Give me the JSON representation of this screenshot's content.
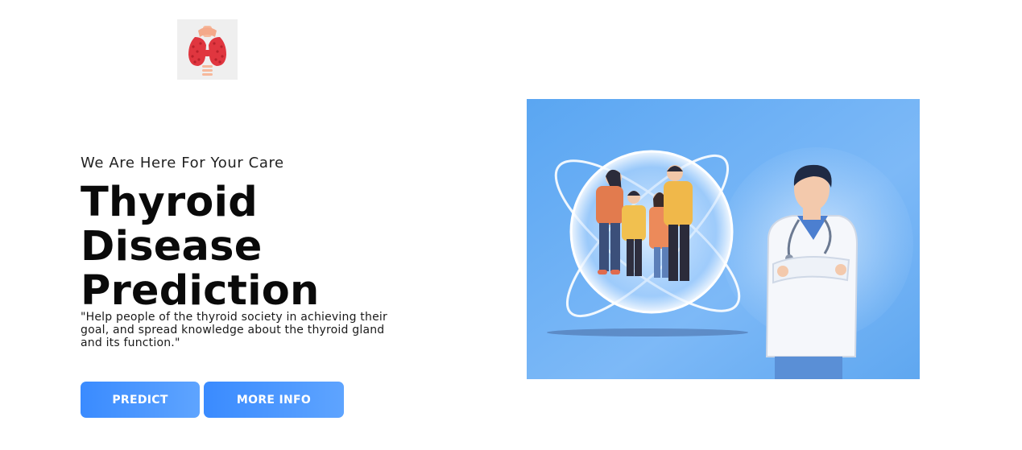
{
  "header": {
    "logo_icon": "thyroid-gland-icon"
  },
  "hero": {
    "tagline": "We Are Here For Your Care",
    "title": "Thyroid Disease Prediction",
    "quote": "\"Help people of the thyroid society in achieving their goal, and spread knowledge about the thyroid gland and its function.\"",
    "illustration": "doctor-and-family-illustration"
  },
  "actions": {
    "predict_label": "PREDICT",
    "more_info_label": "MORE INFO"
  },
  "colors": {
    "button_start": "#3a8bff",
    "button_end": "#5ea4ff",
    "hero_bg": "#6fb0f5",
    "thyroid_red": "#e0363f"
  }
}
